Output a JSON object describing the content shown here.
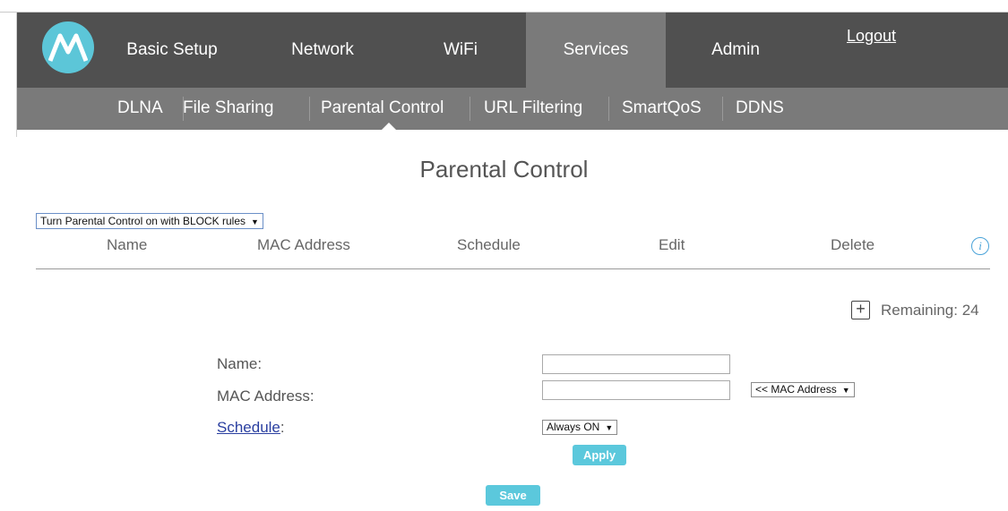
{
  "header": {
    "logo_icon": "motorola-logo-icon",
    "nav": [
      {
        "label": "Basic Setup"
      },
      {
        "label": "Network"
      },
      {
        "label": "WiFi"
      },
      {
        "label": "Services",
        "active": true
      },
      {
        "label": "Admin"
      }
    ],
    "logout_label": "Logout"
  },
  "subnav": {
    "items": [
      {
        "label": "DLNA"
      },
      {
        "label": "File Sharing"
      },
      {
        "label": "Parental Control",
        "active": true
      },
      {
        "label": "URL Filtering"
      },
      {
        "label": "SmartQoS"
      },
      {
        "label": "DDNS"
      }
    ]
  },
  "main": {
    "title": "Parental Control",
    "mode_select": {
      "value": "Turn Parental Control on with BLOCK rules"
    },
    "table": {
      "columns": [
        "Name",
        "MAC Address",
        "Schedule",
        "Edit",
        "Delete"
      ],
      "rows": []
    },
    "add_icon": "plus-icon",
    "remaining_text": "Remaining: 24",
    "form": {
      "name_label": "Name:",
      "name_value": "",
      "mac_label": "MAC Address:",
      "mac_value": "",
      "mac_select_value": "<< MAC Address",
      "schedule_link": "Schedule",
      "schedule_colon": ":",
      "schedule_select_value": "Always ON",
      "apply_label": "Apply"
    },
    "save_label": "Save"
  },
  "colors": {
    "topnav_bg": "#505050",
    "subnav_bg": "#7a7a7a",
    "accent": "#5bc8dc",
    "link": "#2a3fa0"
  }
}
